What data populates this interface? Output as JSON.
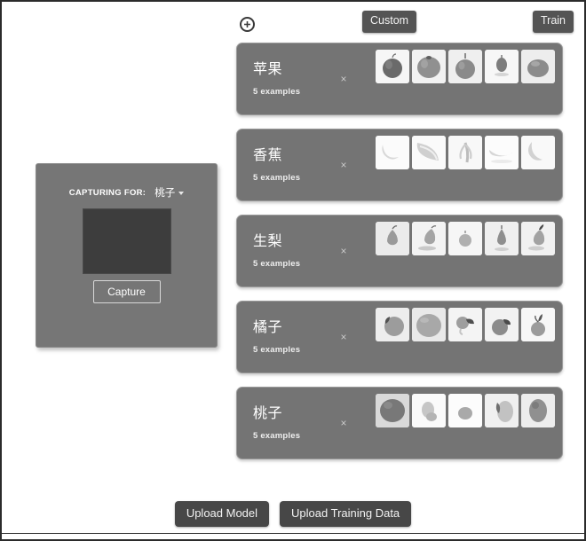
{
  "toolbar": {
    "add_class_icon": "plus-circle-icon",
    "custom_label": "Custom",
    "train_label": "Train"
  },
  "capture_panel": {
    "capturing_for_label": "CAPTURING FOR:",
    "selected_class": "桃子",
    "dropdown_icon": "chevron-down-icon",
    "capture_button_label": "Capture",
    "preview_color": "#3d3d3d",
    "panel_color": "#767676"
  },
  "classes": [
    {
      "name": "苹果",
      "count_label": "5 examples",
      "delete_label": "×",
      "thumbnails": [
        "apple-dark-stem",
        "apple-round-top",
        "apple-tall-stem",
        "apple-small-centered",
        "apple-wide-glossy"
      ]
    },
    {
      "name": "香蕉",
      "count_label": "5 examples",
      "delete_label": "×",
      "thumbnails": [
        "banana-curved-single",
        "banana-crescent-pair",
        "banana-upright-peeled",
        "banana-lying-horizontal",
        "banana-short-curve"
      ]
    },
    {
      "name": "生梨",
      "count_label": "5 examples",
      "delete_label": "×",
      "thumbnails": [
        "pear-upright-stem",
        "pear-tilted-shadow",
        "pear-small-round",
        "pear-tall-slim",
        "pear-dark-stem-curved"
      ]
    },
    {
      "name": "橘子",
      "count_label": "5 examples",
      "delete_label": "×",
      "thumbnails": [
        "tangerine-with-leaf",
        "tangerine-large-round",
        "tangerine-leaf-side",
        "tangerine-dark-leaf",
        "tangerine-small-leaf-top"
      ]
    },
    {
      "name": "桃子",
      "count_label": "5 examples",
      "delete_label": "×",
      "thumbnails": [
        "peach-dark-round",
        "peach-pale-upright",
        "peach-small-centered",
        "peach-with-stem-leaf",
        "peach-oval-shaded"
      ]
    }
  ],
  "footer": {
    "upload_model_label": "Upload Model",
    "upload_training_data_label": "Upload Training Data"
  },
  "colors": {
    "card_bg": "#747474",
    "button_dark": "#545454",
    "footer_button": "#474747",
    "page_bg": "#ffffff",
    "border": "#2b2b2b"
  }
}
